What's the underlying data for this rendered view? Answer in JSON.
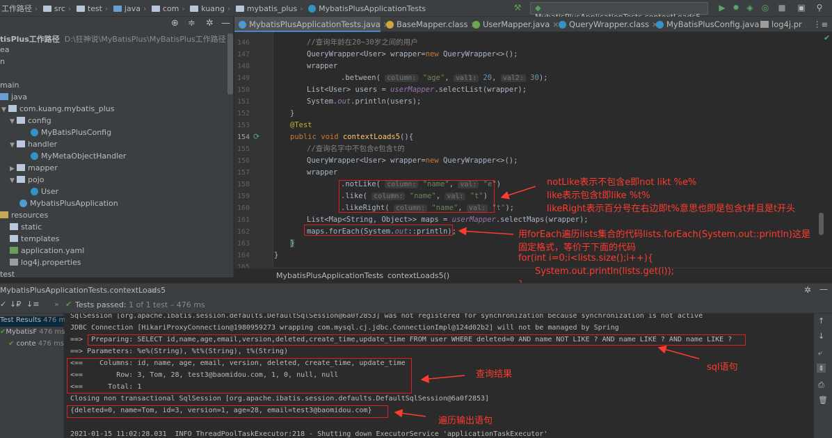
{
  "titlebar": {
    "breadcrumbs": [
      "工作路径",
      "src",
      "test",
      "java",
      "com",
      "kuang",
      "mybatis_plus",
      "MybatisPlusApplicationTests"
    ],
    "run_config": "MybatisPlusApplicationTests.contextLoads5"
  },
  "project": {
    "root_label": "tisPlus工作路径",
    "root_path": "D:\\狂神说\\MyBatisPlus\\MyBatisPlus工作路径",
    "items": [
      {
        "label": "ea"
      },
      {
        "label": "n"
      },
      {
        "label": "main"
      },
      {
        "label": "java"
      },
      {
        "label": "com.kuang.mybatis_plus"
      },
      {
        "label": "config"
      },
      {
        "label": "MyBatisPlusConfig"
      },
      {
        "label": "handler"
      },
      {
        "label": "MyMetaObjectHandler"
      },
      {
        "label": "mapper"
      },
      {
        "label": "pojo"
      },
      {
        "label": "User"
      },
      {
        "label": "MybatisPlusApplication"
      },
      {
        "label": "resources"
      },
      {
        "label": "static"
      },
      {
        "label": "templates"
      },
      {
        "label": "application.yaml"
      },
      {
        "label": "log4j.properties"
      },
      {
        "label": "test"
      }
    ]
  },
  "tabs": [
    {
      "label": "MybatisPlusApplicationTests.java"
    },
    {
      "label": "BaseMapper.class"
    },
    {
      "label": "UserMapper.java"
    },
    {
      "label": "QueryWrapper.class"
    },
    {
      "label": "MyBatisPlusConfig.java"
    },
    {
      "label": "log4j.pr"
    }
  ],
  "editor": {
    "line_numbers": [
      "146",
      "147",
      "148",
      "149",
      "150",
      "151",
      "152",
      "153",
      "154",
      "155",
      "156",
      "157",
      "158",
      "159",
      "160",
      "161",
      "162",
      "163",
      "164",
      "165"
    ],
    "lines": {
      "l146": "//查询年龄在20~30岁之间的用户",
      "l147a": "QueryWrapper<User> wrapper=",
      "l147b": "new",
      "l147c": " QueryWrapper<>();",
      "l148": "wrapper",
      "l149a": ".between(",
      "l149h1": "column:",
      "l149s": "\"age\"",
      "l149h2": "val1:",
      "l149n1": "20",
      "l149h3": "val2:",
      "l149n2": "30",
      "l149e": ");",
      "l150a": "List<User> users = ",
      "l150b": "userMapper",
      "l150c": ".selectList(wrapper);",
      "l151a": "System.",
      "l151b": "out",
      "l151c": ".println(users);",
      "l152": "}",
      "l153": "@Test",
      "l154a": "public void ",
      "l154b": "contextLoads5",
      "l154c": "(){",
      "l155": "//查询名字中不包含e包含t的",
      "l156a": "QueryWrapper<User> wrapper=",
      "l156b": "new",
      "l156c": " QueryWrapper<>();",
      "l157": "wrapper",
      "l158a": ".notLike(",
      "l158h1": "column:",
      "l158s1": "\"name\"",
      "l158h2": "val:",
      "l158s2": "\"e\"",
      "l158e": ")",
      "l159a": ".like(",
      "l159h1": "column:",
      "l159s1": "\"name\"",
      "l159h2": "val:",
      "l159s2": "\"t\"",
      "l159e": ")",
      "l160a": ".likeRight(",
      "l160h1": "column:",
      "l160s1": "\"name\"",
      "l160h2": "val:",
      "l160s2": "\"t\"",
      "l160e": ");",
      "l161a": "List<Map<String, Object>> maps = ",
      "l161b": "userMapper",
      "l161c": ".selectMaps(wrapper);",
      "l162a": "maps.forEach(System.",
      "l162b": "out",
      "l162c": "::println);",
      "l163": "}",
      "l164": "}"
    }
  },
  "editor_breadcrumb": [
    "MybatisPlusApplicationTests",
    "contextLoads5()"
  ],
  "annotations": {
    "like_notes": [
      "notLike表示不包含e即not likt %e%",
      "like表示包含t即like %t%",
      "likeRight表示百分号在右边即t%意思也即是包含t并且是t开头"
    ],
    "foreach_notes": [
      "用forEach遍历lists集合的代码lists.forEach(System.out::println)这是",
      "固定格式，等价于下面的代码",
      "for(int i=0;i<lists.size();i++){",
      "System.out.println(lists.get(i));",
      "}"
    ],
    "sql_note": "sql语句",
    "result_note": "查询结果",
    "output_note": "遍历输出语句"
  },
  "run": {
    "title": "MybatisPlusApplicationTests.contextLoads5",
    "close": "×",
    "tests_passed_label": "Tests passed:",
    "tests_passed_count": "1 of 1 test – 476 ms",
    "tree": [
      {
        "label": "Test Results",
        "time": "476 ms"
      },
      {
        "label": "MybatisF",
        "time": "476 ms"
      },
      {
        "label": "conte",
        "time": "476 ms"
      }
    ]
  },
  "console": {
    "lines": [
      "SqlSession [org.apache.ibatis.session.defaults.DefaultSqlSession@6a0f2853] was not registered for synchronization because synchronization is not active",
      "JDBC Connection [HikariProxyConnection@1980959273 wrapping com.mysql.cj.jdbc.ConnectionImpl@124d02b2] will not be managed by Spring",
      "==>  Preparing: SELECT id,name,age,email,version,deleted,create_time,update_time FROM user WHERE deleted=0 AND name NOT LIKE ? AND name LIKE ? AND name LIKE ?",
      "==> Parameters: %e%(String), %t%(String), t%(String)",
      "<==    Columns: id, name, age, email, version, deleted, create_time, update_time",
      "<==        Row: 3, Tom, 28, test3@baomidou.com, 1, 0, null, null",
      "<==      Total: 1",
      "Closing non transactional SqlSession [org.apache.ibatis.session.defaults.DefaultSqlSession@6a0f2853]",
      "{deleted=0, name=Tom, id=3, version=1, age=28, email=test3@baomidou.com}",
      "",
      "2021-01-15 11:02:28.031  INFO ThreadPoolTaskExecutor:218 - Shutting down ExecutorService 'applicationTaskExecutor'"
    ]
  },
  "colors": {
    "accent": "#4a88c7",
    "annotation_red": "#ff3c2f",
    "pass_green": "#4f9b3f"
  }
}
